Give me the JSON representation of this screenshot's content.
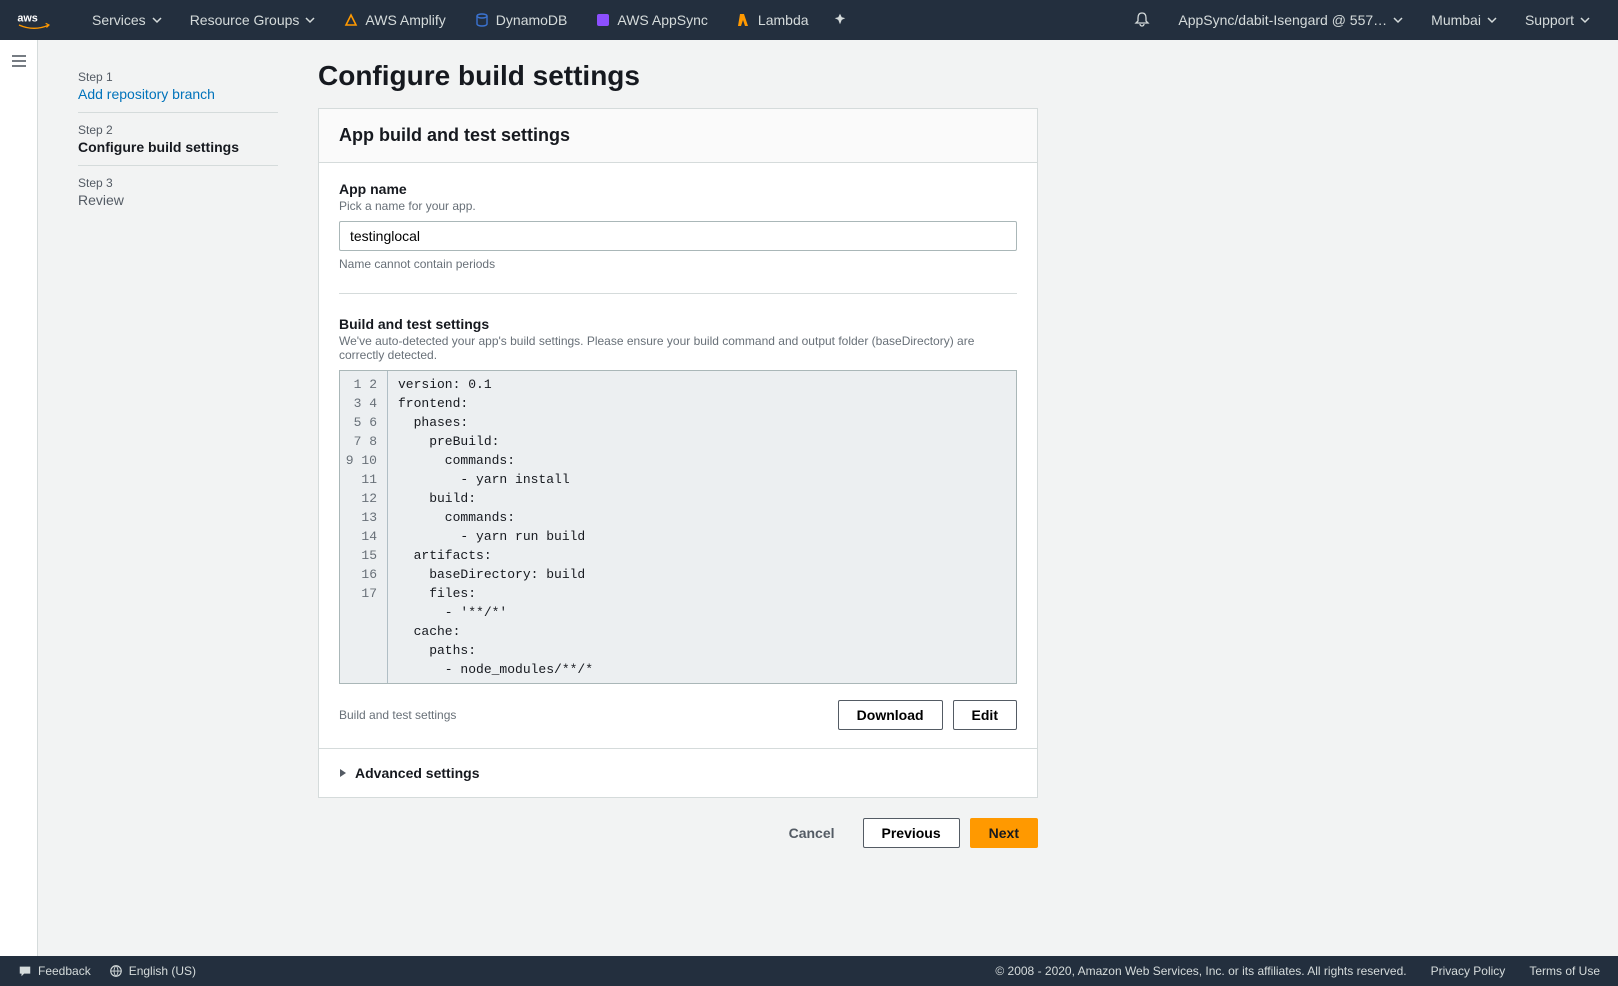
{
  "topnav": {
    "services": "Services",
    "resource_groups": "Resource Groups",
    "shortcuts": [
      {
        "label": "AWS Amplify",
        "color": "#ff9900"
      },
      {
        "label": "DynamoDB",
        "color": "#3b73d1"
      },
      {
        "label": "AWS AppSync",
        "color": "#8c4fff"
      },
      {
        "label": "Lambda",
        "color": "#ff9900"
      }
    ],
    "account": "AppSync/dabit-Isengard @ 557…",
    "region": "Mumbai",
    "support": "Support"
  },
  "steps": [
    {
      "num": "Step 1",
      "title": "Add repository branch",
      "state": "link"
    },
    {
      "num": "Step 2",
      "title": "Configure build settings",
      "state": "active"
    },
    {
      "num": "Step 3",
      "title": "Review",
      "state": "normal"
    }
  ],
  "page": {
    "title": "Configure build settings",
    "panel_title": "App build and test settings",
    "app_name_label": "App name",
    "app_name_desc": "Pick a name for your app.",
    "app_name_value": "testinglocal",
    "app_name_hint": "Name cannot contain periods",
    "build_label": "Build and test settings",
    "build_desc": "We've auto-detected your app's build settings. Please ensure your build command and output folder (baseDirectory) are correctly detected.",
    "code_lines": [
      "version: 0.1",
      "frontend:",
      "  phases:",
      "    preBuild:",
      "      commands:",
      "        - yarn install",
      "    build:",
      "      commands:",
      "        - yarn run build",
      "  artifacts:",
      "    baseDirectory: build",
      "    files:",
      "      - '**/*'",
      "  cache:",
      "    paths:",
      "      - node_modules/**/*",
      ""
    ],
    "settings_footer_label": "Build and test settings",
    "download": "Download",
    "edit": "Edit",
    "advanced": "Advanced settings",
    "cancel": "Cancel",
    "previous": "Previous",
    "next": "Next"
  },
  "footer": {
    "feedback": "Feedback",
    "language": "English (US)",
    "copyright": "© 2008 - 2020, Amazon Web Services, Inc. or its affiliates. All rights reserved.",
    "privacy": "Privacy Policy",
    "terms": "Terms of Use"
  }
}
